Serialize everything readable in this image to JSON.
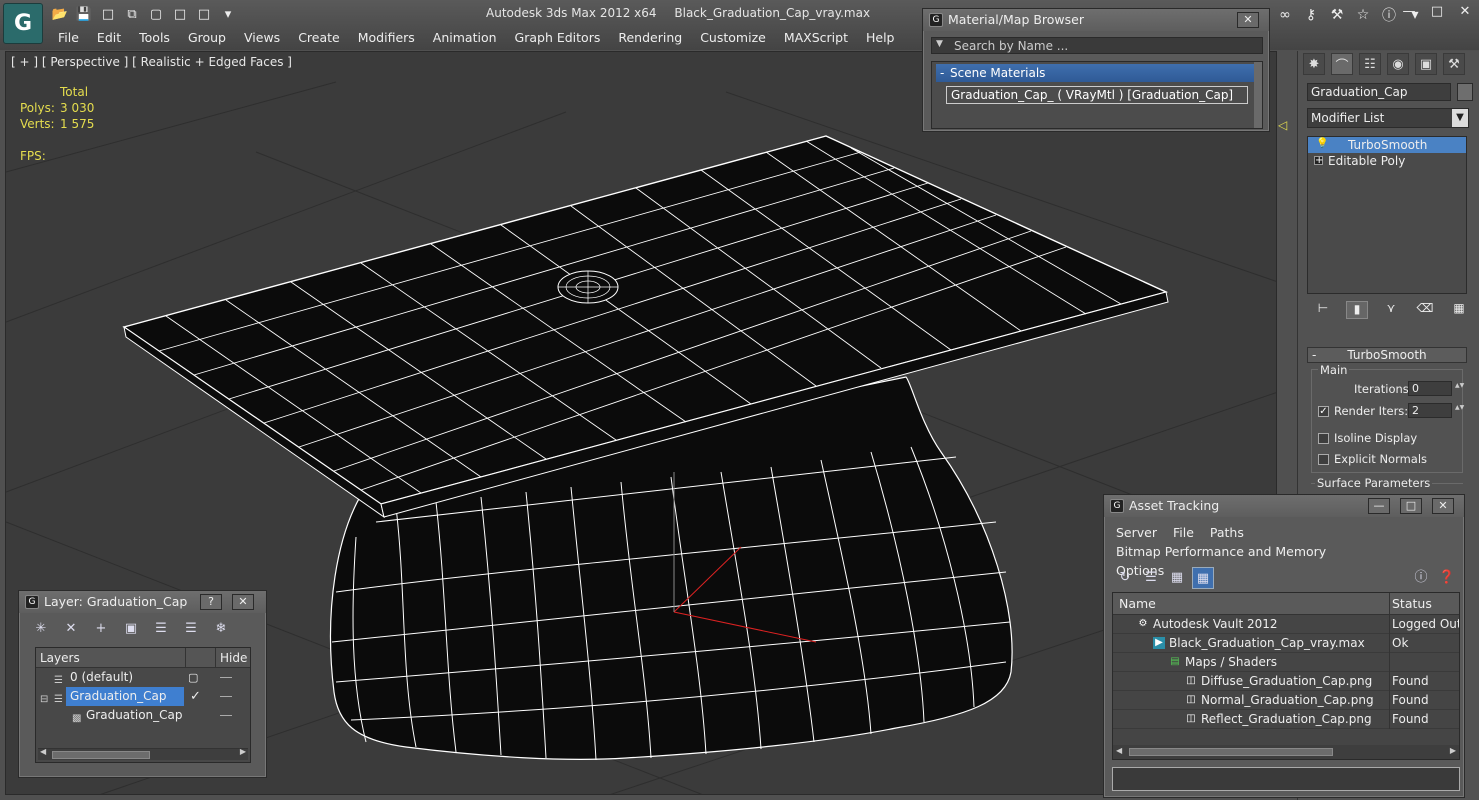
{
  "app": {
    "logo": "G",
    "title_app": "Autodesk 3ds Max  2012 x64",
    "title_file": "Black_Graduation_Cap_vray.max"
  },
  "menus": [
    "File",
    "Edit",
    "Tools",
    "Group",
    "Views",
    "Create",
    "Modifiers",
    "Animation",
    "Graph Editors",
    "Rendering",
    "Customize",
    "MAXScript",
    "Help"
  ],
  "viewport": {
    "label": "[ + ] [ Perspective ] [ Realistic + Edged Faces ]",
    "stats_total": "Total",
    "polys_label": "Polys:",
    "polys_value": "3 030",
    "verts_label": "Verts:",
    "verts_value": "1 575",
    "fps_label": "FPS:"
  },
  "command_panel": {
    "object_name": "Graduation_Cap",
    "modifier_list": "Modifier List",
    "stack": [
      {
        "label": "TurboSmooth",
        "selected": true
      },
      {
        "label": "Editable Poly",
        "selected": false
      }
    ],
    "rollout_title": "TurboSmooth",
    "main_group": "Main",
    "iterations_label": "Iterations:",
    "iterations_value": "0",
    "render_iters_label": "Render Iters:",
    "render_iters_value": "2",
    "render_iters_checked": "✓",
    "isoline_label": "Isoline Display",
    "explicit_normals_label": "Explicit Normals",
    "surface_params_label": "Surface Parameters"
  },
  "material_browser": {
    "title": "Material/Map Browser",
    "search_placeholder": "Search by Name ...",
    "group_label": "Scene Materials",
    "item": "Graduation_Cap_  ( VRayMtl ) [Graduation_Cap]"
  },
  "layer_window": {
    "title": "Layer: Graduation_Cap",
    "help_label": "?",
    "col_layers": "Layers",
    "col_hide": "Hide",
    "rows": [
      {
        "name": "0 (default)"
      },
      {
        "name": "Graduation_Cap"
      },
      {
        "name": "Graduation_Cap"
      }
    ]
  },
  "asset_tracking": {
    "title": "Asset Tracking",
    "menu": [
      "Server",
      "File",
      "Paths",
      "Bitmap Performance and Memory",
      "Options"
    ],
    "col_name": "Name",
    "col_status": "Status",
    "rows": [
      {
        "name": "Autodesk Vault 2012",
        "status": "Logged Out ..."
      },
      {
        "name": "Black_Graduation_Cap_vray.max",
        "status": "Ok"
      },
      {
        "name": "Maps / Shaders",
        "status": ""
      },
      {
        "name": "Diffuse_Graduation_Cap.png",
        "status": "Found"
      },
      {
        "name": "Normal_Graduation_Cap.png",
        "status": "Found"
      },
      {
        "name": "Reflect_Graduation_Cap.png",
        "status": "Found"
      }
    ]
  },
  "colors": {
    "selection_blue": "#4a82c4",
    "stats_yellow": "#e5dd4e",
    "viewport_bg": "#3b3b3b"
  }
}
